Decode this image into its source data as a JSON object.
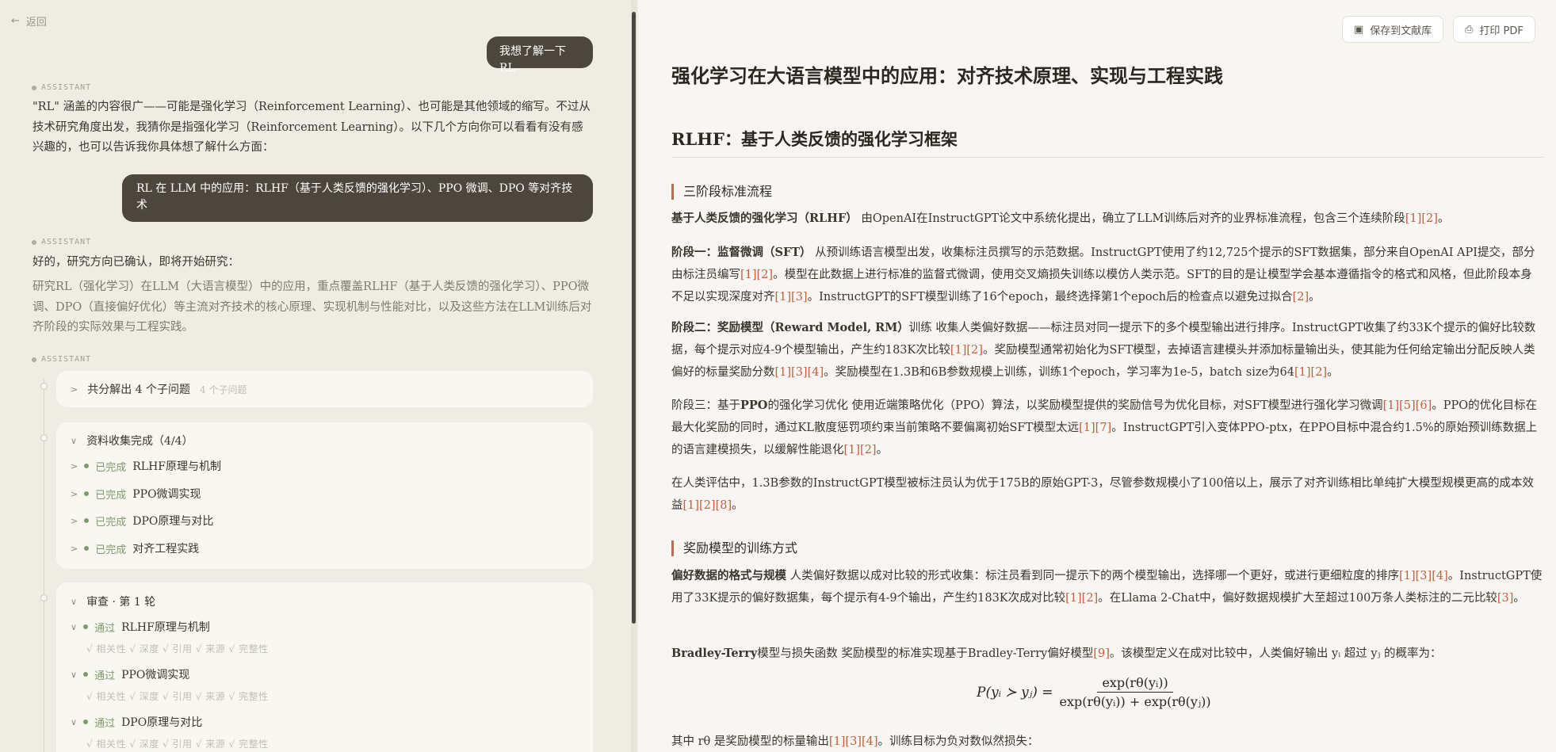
{
  "left": {
    "back_label": "返回",
    "messages": [
      {
        "type": "user",
        "text": "我想了解一下RL"
      },
      {
        "type": "assistant_label",
        "text": "ASSISTANT"
      },
      {
        "type": "assistant",
        "text": "\"RL\" 涵盖的内容很广——可能是强化学习（Reinforcement Learning）、也可能是其他领域的缩写。不过从技术研究角度出发，我猜你是指强化学习（Reinforcement Learning）。以下几个方向你可以看看有没有感兴趣的，也可以告诉我你具体想了解什么方面："
      },
      {
        "type": "user",
        "text": "RL 在 LLM 中的应用：RLHF（基于人类反馈的强化学习）、PPO 微调、DPO 等对齐技术"
      },
      {
        "type": "assistant_label",
        "text": "ASSISTANT"
      },
      {
        "type": "assistant",
        "text": "好的，研究方向已确认，即将开始研究："
      },
      {
        "type": "assistant_muted",
        "text": "研究RL（强化学习）在LLM（大语言模型）中的应用，重点覆盖RLHF（基于人类反馈的强化学习）、PPO微调、DPO（直接偏好优化）等主流对齐技术的核心原理、实现机制与性能对比，以及这些方法在LLM训练后对齐阶段的实际效果与工程实践。"
      },
      {
        "type": "assistant_label",
        "text": "ASSISTANT"
      }
    ],
    "decompose": {
      "title": "共分解出 4 个子问题",
      "sub": "4 个子问题"
    },
    "collect": {
      "title": "资料收集完成（4/4）",
      "items": [
        {
          "status": "已完成",
          "label": "RLHF原理与机制"
        },
        {
          "status": "已完成",
          "label": "PPO微调实现"
        },
        {
          "status": "已完成",
          "label": "DPO原理与对比"
        },
        {
          "status": "已完成",
          "label": "对齐工程实践"
        }
      ]
    },
    "review": {
      "title": "审查 · 第 1 轮",
      "items": [
        {
          "status": "通过",
          "label": "RLHF原理与机制",
          "checks": "√ 相关性  √ 深度  √ 引用  √ 来源  √ 完整性"
        },
        {
          "status": "通过",
          "label": "PPO微调实现",
          "checks": "√ 相关性  √ 深度  √ 引用  √ 来源  √ 完整性"
        },
        {
          "status": "通过",
          "label": "DPO原理与对比",
          "checks": "√ 相关性  √ 深度  √ 引用  √ 来源  √ 完整性"
        }
      ]
    }
  },
  "right": {
    "save_label": "保存到文献库",
    "print_label": "打印 PDF",
    "title": "强化学习在大语言模型中的应用：对齐技术原理、实现与工程实践",
    "section": "RLHF：基于人类反馈的强化学习框架",
    "sub1": "三阶段标准流程",
    "sub2": "奖励模型的训练方式",
    "p_intro_bold": "基于人类反馈的强化学习（RLHF）",
    "p_intro_rest": " 由OpenAI在InstructGPT论文中系统化提出，确立了LLM训练后对齐的业界标准流程，包含三个连续阶段",
    "p_intro_ref": "[1][2]",
    "s1_bold": "阶段一：监督微调（SFT）",
    "s1_a": " 从预训练语言模型出发，收集标注员撰写的示范数据。InstructGPT使用了约12,725个提示的SFT数据集，部分来自OpenAI API提交，部分由标注员编写",
    "s1_ref1": "[1][2]",
    "s1_b": "。模型在此数据上进行标准的监督式微调，使用交叉熵损失训练以模仿人类示范。SFT的目的是让模型学会基本遵循指令的格式和风格，但此阶段本身不足以实现深度对齐",
    "s1_ref2": "[1][3]",
    "s1_c": "。InstructGPT的SFT模型训练了16个epoch，最终选择第1个epoch后的检查点以避免过拟合",
    "s1_ref3": "[2]",
    "s2_bold": "阶段二：奖励模型（Reward Model, RM）",
    "s2_a": "训练 收集人类偏好数据——标注员对同一提示下的多个模型输出进行排序。InstructGPT收集了约33K个提示的偏好比较数据，每个提示对应4-9个模型输出，产生约183K次比较",
    "s2_ref1": "[1][2]",
    "s2_b": "。奖励模型通常初始化为SFT模型，去掉语言建模头并添加标量输出头，使其能为任何给定输出分配反映人类偏好的标量奖励分数",
    "s2_ref2": "[1][3][4]",
    "s2_c": "。奖励模型在1.3B和6B参数规模上训练，训练1个epoch，学习率为1e-5，batch size为64",
    "s2_ref3": "[1][2]",
    "s3_bold_a": "阶段三：基于",
    "s3_bold_b": "PPO",
    "s3_bold_c": "的强化学习优化",
    "s3_a": " 使用近端策略优化（PPO）算法，以奖励模型提供的奖励信号为优化目标，对SFT模型进行强化学习微调",
    "s3_ref1": "[1][5][6]",
    "s3_b": "。PPO的优化目标在最大化奖励的同时，通过KL散度惩罚项约束当前策略不要偏离初始SFT模型太远",
    "s3_ref2": "[1][7]",
    "s3_c": "。InstructGPT引入变体PPO-ptx，在PPO目标中混合约1.5%的原始预训练数据上的语言建模损失，以缓解性能退化",
    "s3_ref3": "[1][2]",
    "p_eval": "在人类评估中，1.3B参数的InstructGPT模型被标注员认为优于175B的原始GPT-3，尽管参数规模小了100倍以上，展示了对齐训练相比单纯扩大模型规模更高的成本效益",
    "p_eval_ref": "[1][2][8]",
    "pref_bold": "偏好数据的格式与规模",
    "pref_a": " 人类偏好数据以成对比较的形式收集：标注员看到同一提示下的两个模型输出，选择哪一个更好，或进行更细粒度的排序",
    "pref_ref1": "[1][3][4]",
    "pref_b": "。InstructGPT使用了33K提示的偏好数据集，每个提示有4-9个输出，产生约183K次成对比较",
    "pref_ref2": "[1][2]",
    "pref_c": "。在Llama 2-Chat中，偏好数据规模扩大至超过100万条人类标注的二元比较",
    "pref_ref3": "[3]",
    "bt_bold": "Bradley-Terry",
    "bt_a": "模型与损失函数 奖励模型的标准实现基于Bradley-Terry偏好模型",
    "bt_ref": "[9]",
    "bt_b": "。该模型定义在成对比较中，人类偏好输出 yᵢ 超过 yⱼ 的概率为：",
    "formula_lhs": "P(yᵢ ≻ yⱼ) =",
    "formula_num": "exp(rθ(yᵢ))",
    "formula_den": "exp(rθ(yᵢ)) + exp(rθ(yⱼ))",
    "last_a": "其中 rθ 是奖励模型的标量输出",
    "last_ref": "[1][3][4]",
    "last_b": "。训练目标为负对数似然损失："
  }
}
